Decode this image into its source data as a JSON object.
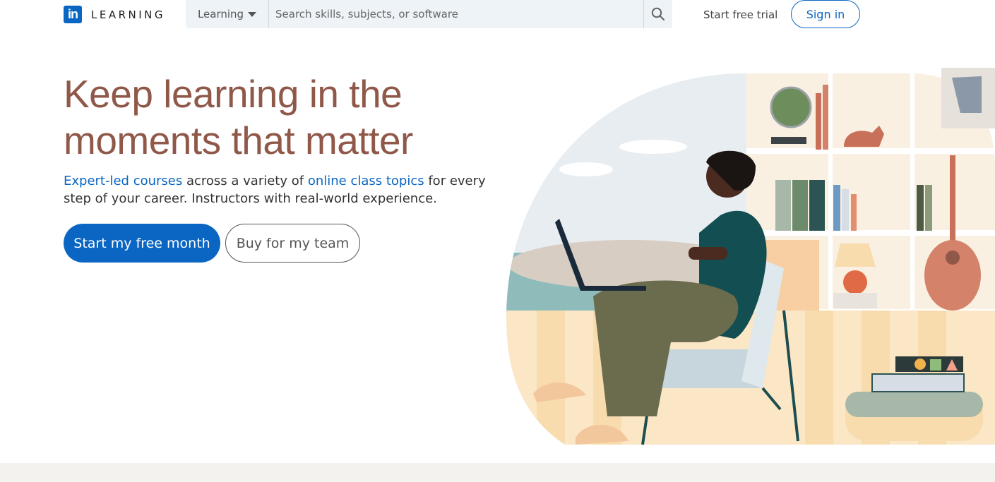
{
  "header": {
    "logo_mark": "in",
    "logo_word": "LEARNING",
    "search_category": "Learning",
    "search_placeholder": "Search skills, subjects, or software",
    "start_trial": "Start free trial",
    "sign_in": "Sign in"
  },
  "hero": {
    "title_line1": "Keep learning in the",
    "title_line2": "moments that matter",
    "sub_link1": "Expert-led courses",
    "sub_text1": " across a variety of ",
    "sub_link2": "online class topics",
    "sub_text2": " for every step of your career. Instructors with real-world experience.",
    "primary_cta": "Start my free month",
    "secondary_cta": "Buy for my team"
  },
  "colors": {
    "brand": "#0a66c2",
    "title": "#8f5849",
    "search_bg": "#eef3f8",
    "footer": "#f3f2ef"
  },
  "icons": [
    "search-icon",
    "caret-down-icon"
  ]
}
